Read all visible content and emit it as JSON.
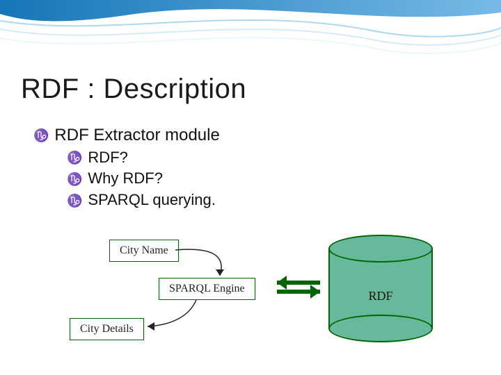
{
  "title": "RDF : Description",
  "bullets": {
    "main": "RDF Extractor module",
    "subs": [
      " RDF?",
      "Why RDF?",
      "SPARQL querying."
    ]
  },
  "diagram": {
    "city_name": "City Name",
    "sparql_engine": "SPARQL Engine",
    "city_details": "City Details",
    "rdf": "RDF"
  },
  "icons": {
    "bullet_glyph": "♑"
  },
  "colors": {
    "accent": "#006600",
    "wave": "#0a6fb3",
    "cyl_fill": "#66b99a"
  }
}
